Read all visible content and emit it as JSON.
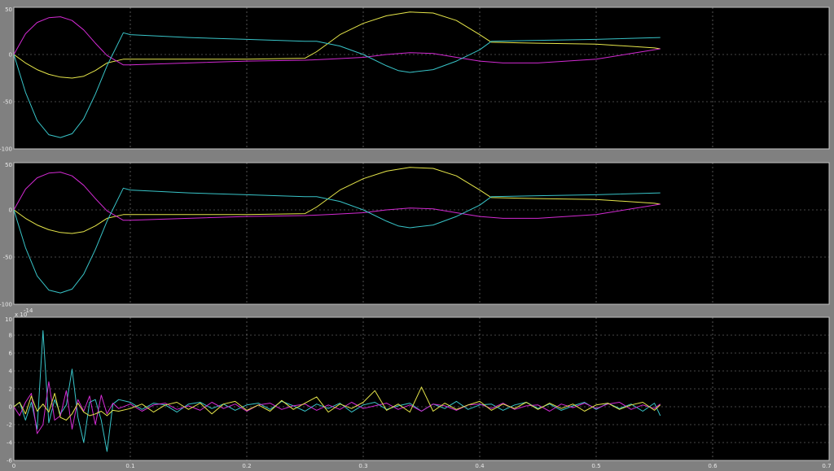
{
  "colors": {
    "figure_bg": "#808080",
    "axes_bg": "#000000",
    "axes_frame": "#c0c0c0",
    "grid": "#c8c8c8",
    "tick_text": "#e8e8e8",
    "series": {
      "yellow": "#e6e64a",
      "magenta": "#d22ad2",
      "cyan": "#38c4c8"
    }
  },
  "chart_data": [
    {
      "type": "line",
      "title": "",
      "xlabel": "",
      "ylabel": "",
      "xlim": [
        0,
        0.7
      ],
      "ylim": [
        -100,
        50
      ],
      "xticks": [],
      "yticks": [
        "50",
        "0",
        "-50",
        "-100"
      ],
      "grid": true,
      "series": [
        {
          "color": "yellow",
          "x": [
            0,
            0.01,
            0.02,
            0.03,
            0.04,
            0.05,
            0.06,
            0.07,
            0.08,
            0.094,
            0.1,
            0.15,
            0.2,
            0.25,
            0.26,
            0.27,
            0.28,
            0.3,
            0.32,
            0.34,
            0.36,
            0.38,
            0.4,
            0.41,
            0.45,
            0.5,
            0.55,
            0.555
          ],
          "y": [
            0,
            -9,
            -16,
            -21,
            -24,
            -25,
            -23,
            -17,
            -9,
            -5,
            -5,
            -5,
            -5,
            -4,
            3,
            12,
            21,
            33,
            41,
            45,
            44,
            36,
            21,
            13,
            12,
            11,
            7,
            6
          ]
        },
        {
          "color": "magenta",
          "x": [
            0,
            0.01,
            0.02,
            0.03,
            0.04,
            0.05,
            0.06,
            0.07,
            0.08,
            0.094,
            0.1,
            0.15,
            0.2,
            0.25,
            0.27,
            0.3,
            0.32,
            0.34,
            0.36,
            0.38,
            0.4,
            0.42,
            0.45,
            0.5,
            0.53,
            0.555
          ],
          "y": [
            0,
            22,
            34,
            39,
            40,
            36,
            26,
            12,
            -1,
            -11,
            -11,
            -9,
            -7,
            -6,
            -5,
            -3,
            0,
            2,
            1,
            -3,
            -7,
            -9,
            -9,
            -5,
            1,
            6
          ]
        },
        {
          "color": "cyan",
          "x": [
            0,
            0.01,
            0.02,
            0.03,
            0.04,
            0.05,
            0.06,
            0.07,
            0.08,
            0.094,
            0.1,
            0.15,
            0.2,
            0.25,
            0.26,
            0.28,
            0.3,
            0.32,
            0.33,
            0.34,
            0.36,
            0.38,
            0.4,
            0.41,
            0.45,
            0.5,
            0.555
          ],
          "y": [
            0,
            -40,
            -70,
            -85,
            -88,
            -84,
            -68,
            -42,
            -12,
            23,
            21,
            18,
            16,
            14,
            14,
            9,
            0,
            -12,
            -17,
            -19,
            -16,
            -7,
            5,
            14,
            15,
            16,
            18
          ]
        }
      ]
    },
    {
      "type": "line",
      "title": "",
      "xlabel": "",
      "ylabel": "",
      "xlim": [
        0,
        0.7
      ],
      "ylim": [
        -100,
        50
      ],
      "xticks": [],
      "yticks": [
        "50",
        "0",
        "-50",
        "-100"
      ],
      "grid": true,
      "series": [
        {
          "color": "yellow",
          "x": [
            0,
            0.01,
            0.02,
            0.03,
            0.04,
            0.05,
            0.06,
            0.07,
            0.08,
            0.094,
            0.1,
            0.15,
            0.2,
            0.25,
            0.26,
            0.27,
            0.28,
            0.3,
            0.32,
            0.34,
            0.36,
            0.38,
            0.4,
            0.41,
            0.45,
            0.5,
            0.55,
            0.555
          ],
          "y": [
            0,
            -9,
            -16,
            -21,
            -24,
            -25,
            -23,
            -17,
            -9,
            -5,
            -5,
            -5,
            -5,
            -4,
            3,
            12,
            21,
            33,
            41,
            45,
            44,
            36,
            21,
            13,
            12,
            11,
            7,
            6
          ]
        },
        {
          "color": "magenta",
          "x": [
            0,
            0.01,
            0.02,
            0.03,
            0.04,
            0.05,
            0.06,
            0.07,
            0.08,
            0.094,
            0.1,
            0.15,
            0.2,
            0.25,
            0.27,
            0.3,
            0.32,
            0.34,
            0.36,
            0.38,
            0.4,
            0.42,
            0.45,
            0.5,
            0.53,
            0.555
          ],
          "y": [
            0,
            22,
            34,
            39,
            40,
            36,
            26,
            12,
            -1,
            -11,
            -11,
            -9,
            -7,
            -6,
            -5,
            -3,
            0,
            2,
            1,
            -3,
            -7,
            -9,
            -9,
            -5,
            1,
            6
          ]
        },
        {
          "color": "cyan",
          "x": [
            0,
            0.01,
            0.02,
            0.03,
            0.04,
            0.05,
            0.06,
            0.07,
            0.08,
            0.094,
            0.1,
            0.15,
            0.2,
            0.25,
            0.26,
            0.28,
            0.3,
            0.32,
            0.33,
            0.34,
            0.36,
            0.38,
            0.4,
            0.41,
            0.45,
            0.5,
            0.555
          ],
          "y": [
            0,
            -40,
            -70,
            -85,
            -88,
            -84,
            -68,
            -42,
            -12,
            23,
            21,
            18,
            16,
            14,
            14,
            9,
            0,
            -12,
            -17,
            -19,
            -16,
            -7,
            5,
            14,
            15,
            16,
            18
          ]
        }
      ]
    },
    {
      "type": "line",
      "title": "",
      "xlabel": "",
      "ylabel": "",
      "exponent_label": "x 10",
      "exponent_power": "-14",
      "xlim": [
        0,
        0.7
      ],
      "ylim": [
        -6,
        10
      ],
      "xticks": [
        "0",
        "0.1",
        "0.2",
        "0.3",
        "0.4",
        "0.5",
        "0.6",
        "0.7"
      ],
      "yticks": [
        "10",
        "8",
        "6",
        "4",
        "2",
        "0",
        "-2",
        "-4",
        "-6"
      ],
      "grid": true,
      "series": [
        {
          "color": "cyan",
          "x": [
            0,
            0.005,
            0.01,
            0.015,
            0.02,
            0.025,
            0.03,
            0.035,
            0.04,
            0.045,
            0.05,
            0.055,
            0.06,
            0.065,
            0.07,
            0.075,
            0.08,
            0.085,
            0.09,
            0.1,
            0.11,
            0.12,
            0.13,
            0.14,
            0.15,
            0.16,
            0.17,
            0.18,
            0.19,
            0.2,
            0.21,
            0.22,
            0.23,
            0.24,
            0.25,
            0.26,
            0.27,
            0.28,
            0.29,
            0.3,
            0.31,
            0.32,
            0.33,
            0.34,
            0.35,
            0.36,
            0.37,
            0.38,
            0.39,
            0.4,
            0.41,
            0.42,
            0.43,
            0.44,
            0.45,
            0.46,
            0.47,
            0.48,
            0.49,
            0.5,
            0.51,
            0.52,
            0.53,
            0.54,
            0.55,
            0.555
          ],
          "y": [
            0,
            0.5,
            -1.5,
            0.5,
            -2.5,
            8.5,
            -1.8,
            0.8,
            -0.8,
            0.2,
            4.2,
            -1.2,
            -4,
            0.5,
            0.8,
            -1.5,
            -5,
            0.3,
            0.8,
            0.5,
            -0.3,
            0.4,
            0.2,
            -0.6,
            0.3,
            0.5,
            -0.2,
            0.3,
            -0.4,
            0.2,
            0.4,
            -0.3,
            0.6,
            0.1,
            -0.5,
            0.3,
            -0.2,
            0.4,
            -0.6,
            0.2,
            0.5,
            -0.3,
            0.1,
            0.4,
            -0.5,
            0.3,
            -0.2,
            0.6,
            -0.3,
            0.2,
            0.3,
            -0.4,
            0.2,
            0.5,
            -0.2,
            0.3,
            -0.4,
            0.1,
            0.5,
            -0.3,
            0.4,
            -0.2,
            0.3,
            -0.5,
            0.4,
            -1.0
          ]
        },
        {
          "color": "magenta",
          "x": [
            0,
            0.005,
            0.01,
            0.015,
            0.02,
            0.025,
            0.03,
            0.035,
            0.04,
            0.045,
            0.05,
            0.055,
            0.06,
            0.065,
            0.07,
            0.075,
            0.08,
            0.085,
            0.09,
            0.1,
            0.11,
            0.12,
            0.13,
            0.14,
            0.15,
            0.16,
            0.17,
            0.18,
            0.19,
            0.2,
            0.21,
            0.22,
            0.23,
            0.24,
            0.25,
            0.26,
            0.27,
            0.28,
            0.29,
            0.3,
            0.31,
            0.32,
            0.33,
            0.34,
            0.35,
            0.36,
            0.37,
            0.38,
            0.39,
            0.4,
            0.41,
            0.42,
            0.43,
            0.44,
            0.45,
            0.46,
            0.47,
            0.48,
            0.49,
            0.5,
            0.51,
            0.52,
            0.53,
            0.54,
            0.55,
            0.555
          ],
          "y": [
            0,
            -1,
            0.5,
            1.5,
            -3,
            -2,
            2.8,
            -1.5,
            -1,
            1.8,
            -2.5,
            0.8,
            -0.5,
            1.2,
            -2,
            1.3,
            -0.8,
            0.4,
            -0.2,
            0.3,
            -0.5,
            0.2,
            0.4,
            -0.3,
            0.1,
            -0.4,
            0.5,
            -0.2,
            0.3,
            -0.5,
            0.2,
            0.4,
            -0.3,
            0.1,
            0.3,
            -0.4,
            0.2,
            -0.3,
            0.5,
            -0.2,
            0.1,
            0.4,
            -0.3,
            0.2,
            -0.5,
            0.3,
            0.1,
            -0.4,
            0.2,
            0.3,
            -0.2,
            0.4,
            -0.3,
            0.1,
            0.2,
            -0.5,
            0.3,
            -0.1,
            0.4,
            -0.2,
            0.3,
            0.5,
            -0.3,
            0.2,
            -0.2,
            0.3
          ]
        },
        {
          "color": "yellow",
          "x": [
            0,
            0.005,
            0.01,
            0.015,
            0.02,
            0.025,
            0.03,
            0.035,
            0.04,
            0.045,
            0.05,
            0.055,
            0.06,
            0.065,
            0.07,
            0.075,
            0.08,
            0.085,
            0.09,
            0.1,
            0.11,
            0.12,
            0.13,
            0.14,
            0.15,
            0.16,
            0.17,
            0.18,
            0.19,
            0.2,
            0.21,
            0.22,
            0.23,
            0.24,
            0.25,
            0.26,
            0.27,
            0.28,
            0.29,
            0.3,
            0.31,
            0.32,
            0.33,
            0.34,
            0.35,
            0.36,
            0.37,
            0.38,
            0.39,
            0.4,
            0.41,
            0.42,
            0.43,
            0.44,
            0.45,
            0.46,
            0.47,
            0.48,
            0.49,
            0.5,
            0.51,
            0.52,
            0.53,
            0.54,
            0.55,
            0.555
          ],
          "y": [
            0,
            0.5,
            -0.8,
            1.2,
            -0.5,
            0.3,
            -0.6,
            1.5,
            -1.2,
            -1.5,
            -0.8,
            0.4,
            -0.6,
            -1,
            -0.8,
            -0.5,
            -1,
            -0.4,
            -0.5,
            -0.2,
            0.3,
            -0.6,
            0.2,
            0.5,
            -0.3,
            0.4,
            -0.8,
            0.3,
            0.6,
            -0.4,
            0.2,
            -0.5,
            0.7,
            -0.3,
            0.4,
            1.1,
            -0.6,
            0.3,
            -0.2,
            0.5,
            1.8,
            -0.4,
            0.3,
            -0.6,
            2.2,
            -0.5,
            0.4,
            -0.3,
            0.2,
            0.6,
            -0.4,
            0.3,
            -0.2,
            0.5,
            -0.3,
            0.4,
            -0.2,
            0.3,
            -0.5,
            0.2,
            0.4,
            -0.3,
            0.2,
            0.5,
            -0.4,
            0.2
          ]
        }
      ]
    }
  ]
}
